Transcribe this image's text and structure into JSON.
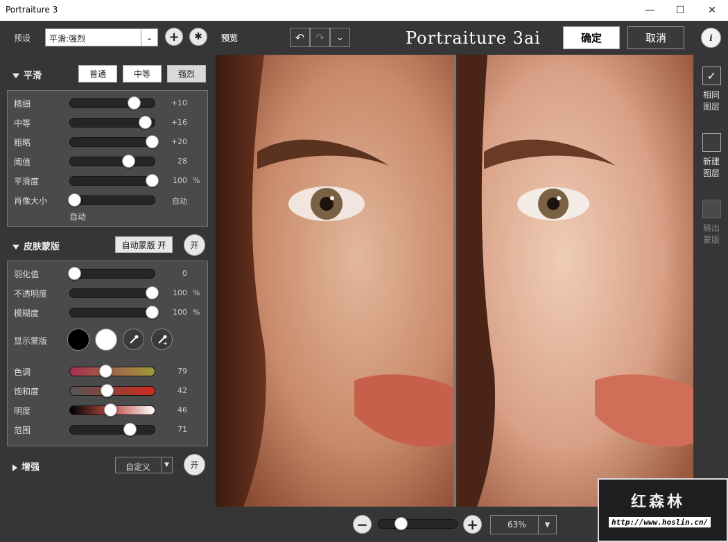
{
  "window": {
    "title": "Portraiture 3",
    "controls": [
      "minimize",
      "maximize",
      "close"
    ]
  },
  "preset": {
    "label": "预设",
    "value": "平滑:强烈"
  },
  "toolbar": {
    "preview_label": "预览",
    "logo": "Portraiture 3ai",
    "ok": "确定",
    "cancel": "取消"
  },
  "smoothing": {
    "title": "平滑",
    "levels": [
      "普通",
      "中等",
      "强烈"
    ],
    "active_level": "强烈",
    "sliders": [
      {
        "label": "精细",
        "value": "+10",
        "unit": "",
        "pos": 0.74
      },
      {
        "label": "中等",
        "value": "+16",
        "unit": "",
        "pos": 0.87
      },
      {
        "label": "粗略",
        "value": "+20",
        "unit": "",
        "pos": 0.95
      },
      {
        "label": "阈值",
        "value": "28",
        "unit": "",
        "pos": 0.68
      },
      {
        "label": "平滑度",
        "value": "100",
        "unit": "%",
        "pos": 0.95
      },
      {
        "label": "肖像大小",
        "value": "自动",
        "unit": "",
        "pos": 0.05
      }
    ],
    "portrait_size_note": "自动"
  },
  "skin_mask": {
    "title": "皮肤蒙版",
    "auto_mask_button": "自动蒙版 开",
    "toggle": "开",
    "sliders": [
      {
        "label": "羽化值",
        "value": "0",
        "unit": "",
        "pos": 0.05
      },
      {
        "label": "不透明度",
        "value": "100",
        "unit": "%",
        "pos": 0.95
      },
      {
        "label": "模糊度",
        "value": "100",
        "unit": "%",
        "pos": 0.95
      }
    ],
    "show_mask_label": "显示蒙版",
    "color_sliders": [
      {
        "label": "色调",
        "value": "79",
        "pos": 0.41
      },
      {
        "label": "饱和度",
        "value": "42",
        "pos": 0.43
      },
      {
        "label": "明度",
        "value": "46",
        "pos": 0.47
      },
      {
        "label": "范围",
        "value": "71",
        "pos": 0.69
      }
    ]
  },
  "enhance": {
    "title": "增强",
    "mode": "自定义",
    "toggle": "开"
  },
  "right_panel": {
    "items": [
      {
        "label1": "相同",
        "label2": "图层",
        "checked": true
      },
      {
        "label1": "新建",
        "label2": "图层",
        "checked": false
      },
      {
        "label1": "输出",
        "label2": "蒙版",
        "checked": false
      }
    ]
  },
  "zoom": {
    "level": "63%",
    "pos": 0.28
  },
  "watermark": {
    "title": "红森林",
    "url": "http://www.hoslin.cn/"
  }
}
